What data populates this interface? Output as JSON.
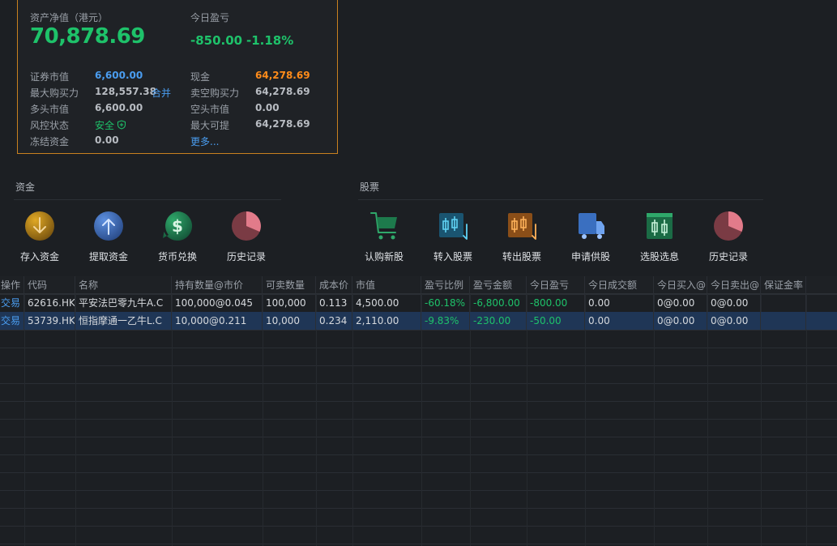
{
  "summary": {
    "net_assets_label": "资产净值（港元）",
    "net_assets_value": "70,878.69",
    "today_pnl_label": "今日盈亏",
    "today_pnl_value": "-850.00",
    "today_pnl_pct": "-1.18%",
    "fields_left": [
      {
        "label": "证券市值",
        "value": "6,600.00",
        "color": "blue"
      },
      {
        "label": "最大购买力",
        "value": "128,557.38",
        "color": "grey",
        "link": "合并"
      },
      {
        "label": "多头市值",
        "value": "6,600.00",
        "color": "grey"
      },
      {
        "label": "风控状态",
        "value": "安全",
        "color": "green",
        "icon": "shield-icon"
      },
      {
        "label": "冻结资金",
        "value": "0.00",
        "color": "grey"
      }
    ],
    "fields_right": [
      {
        "label": "现金",
        "value": "64,278.69",
        "color": "orange"
      },
      {
        "label": "卖空购买力",
        "value": "64,278.69",
        "color": "grey"
      },
      {
        "label": "空头市值",
        "value": "0.00",
        "color": "grey"
      },
      {
        "label": "最大可提",
        "value": "64,278.69",
        "color": "grey"
      }
    ],
    "more_link": "更多..."
  },
  "funds": {
    "title": "资金",
    "tools": [
      {
        "label": "存入资金",
        "icon": "deposit-icon"
      },
      {
        "label": "提取资金",
        "icon": "withdraw-icon"
      },
      {
        "label": "货币兑换",
        "icon": "currency-exchange-icon"
      },
      {
        "label": "历史记录",
        "icon": "history-pie-icon"
      }
    ]
  },
  "stocks": {
    "title": "股票",
    "tools": [
      {
        "label": "认购新股",
        "icon": "cart-icon"
      },
      {
        "label": "转入股票",
        "icon": "transfer-in-icon"
      },
      {
        "label": "转出股票",
        "icon": "transfer-out-icon"
      },
      {
        "label": "申请供股",
        "icon": "truck-icon"
      },
      {
        "label": "选股选息",
        "icon": "candlestick-icon"
      },
      {
        "label": "历史记录",
        "icon": "history-pie-icon"
      }
    ]
  },
  "table": {
    "headers": [
      "操作",
      "代码",
      "名称",
      "持有数量@市价",
      "可卖数量",
      "成本价",
      "市值",
      "盈亏比例",
      "盈亏金额",
      "今日盈亏",
      "今日成交额",
      "今日买入@",
      "今日卖出@",
      "保证金率"
    ],
    "rows": [
      [
        "交易",
        "62616.HK",
        "平安法巴零九牛A.C",
        "100,000@0.045",
        "100,000",
        "0.113",
        "4,500.00",
        "-60.18%",
        "-6,800.00",
        "-800.00",
        "0.00",
        "0@0.00",
        "0@0.00",
        ""
      ],
      [
        "交易",
        "53739.HK",
        "恒指摩通一乙牛L.C",
        "10,000@0.211",
        "10,000",
        "0.234",
        "2,110.00",
        "-9.83%",
        "-230.00",
        "-50.00",
        "0.00",
        "0@0.00",
        "0@0.00",
        ""
      ]
    ]
  },
  "colors": {
    "accent_blue": "#4a9df0",
    "profit_green": "#1ec26a",
    "cash_orange": "#ff8c1a",
    "card_border": "#c8811f",
    "selected_row": "#1f3656"
  }
}
